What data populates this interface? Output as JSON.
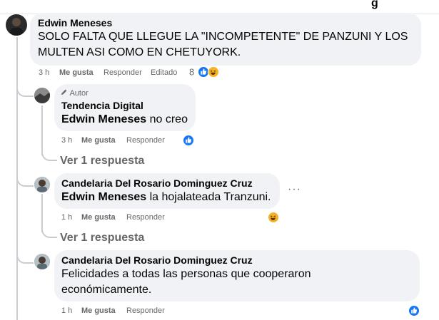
{
  "top_fragment": "g",
  "comment": {
    "author": "Edwin Meneses",
    "text_line1": "SOLO FALTA QUE LLEGUE LA \"INCOMPETENTE\" DE PANZUNI Y LOS",
    "text_line2": "MULTEN ASI COMO EN CHETUYORK.",
    "time": "3 h",
    "like_label": "Me gusta",
    "reply_label": "Responder",
    "edited_label": "Editado",
    "reaction_count": "8"
  },
  "replies": [
    {
      "badge": "Autor",
      "author": "Tendencia Digital",
      "mention": "Edwin Meneses",
      "text": " no creo",
      "time": "3 h",
      "like_label": "Me gusta",
      "reply_label": "Responder",
      "view_more": "Ver 1 respuesta"
    },
    {
      "author": "Candelaria Del Rosario Dominguez Cruz",
      "mention": "Edwin Meneses",
      "text": " la hojalateada Tranzuni.",
      "time": "1 h",
      "like_label": "Me gusta",
      "reply_label": "Responder",
      "more_icon": "more-dots-icon",
      "view_more": "Ver 1 respuesta"
    },
    {
      "author": "Candelaria Del Rosario Dominguez Cruz",
      "text_line1": "Felicidades a todas las personas que cooperaron",
      "text_line2": "económicamente.",
      "time": "1 h",
      "like_label": "Me gusta",
      "reply_label": "Responder"
    }
  ],
  "colors": {
    "bubble": "#f0f2f5",
    "like_blue": "#1877f2",
    "haha_yellow": "#f7b125",
    "meta_gray": "#65676b",
    "thread_line": "#c9ccd1"
  },
  "icons": [
    "author-pen-icon",
    "like-reaction-icon",
    "haha-reaction-icon",
    "more-dots-icon"
  ]
}
